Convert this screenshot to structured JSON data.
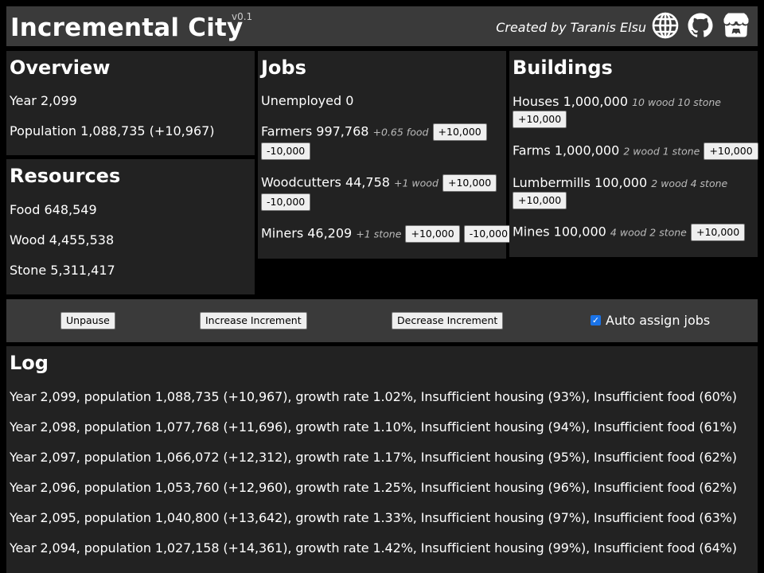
{
  "header": {
    "title": "Incremental City",
    "version": "v0.1",
    "credit": "Created by Taranis Elsu"
  },
  "overview": {
    "title": "Overview",
    "year": "Year 2,099",
    "population": "Population 1,088,735 (+10,967)"
  },
  "resources": {
    "title": "Resources",
    "food": "Food 648,549",
    "wood": "Wood 4,455,538",
    "stone": "Stone 5,311,417"
  },
  "jobs": {
    "title": "Jobs",
    "unemployed": "Unemployed 0",
    "farmers": {
      "label": "Farmers 997,768",
      "yield": "+0.65 food",
      "inc": "+10,000",
      "dec": "-10,000"
    },
    "woodcutters": {
      "label": "Woodcutters 44,758",
      "yield": "+1 wood",
      "inc": "+10,000",
      "dec": "-10,000"
    },
    "miners": {
      "label": "Miners 46,209",
      "yield": "+1 stone",
      "inc": "+10,000",
      "dec": "-10,000"
    }
  },
  "buildings": {
    "title": "Buildings",
    "houses": {
      "label": "Houses 1,000,000",
      "cost": "10 wood 10 stone",
      "inc": "+10,000"
    },
    "farms": {
      "label": "Farms 1,000,000",
      "cost": "2 wood 1 stone",
      "inc": "+10,000"
    },
    "lumbermills": {
      "label": "Lumbermills 100,000",
      "cost": "2 wood 4 stone",
      "inc": "+10,000"
    },
    "mines": {
      "label": "Mines 100,000",
      "cost": "4 wood 2 stone",
      "inc": "+10,000"
    }
  },
  "controls": {
    "unpause": "Unpause",
    "increase": "Increase Increment",
    "decrease": "Decrease Increment",
    "auto_assign": "Auto assign jobs",
    "auto_assign_checked": true
  },
  "log": {
    "title": "Log",
    "entries": [
      "Year 2,099, population 1,088,735 (+10,967), growth rate 1.02%, Insufficient housing (93%), Insufficient food (60%)",
      "Year 2,098, population 1,077,768 (+11,696), growth rate 1.10%, Insufficient housing (94%), Insufficient food (61%)",
      "Year 2,097, population 1,066,072 (+12,312), growth rate 1.17%, Insufficient housing (95%), Insufficient food (62%)",
      "Year 2,096, population 1,053,760 (+12,960), growth rate 1.25%, Insufficient housing (96%), Insufficient food (62%)",
      "Year 2,095, population 1,040,800 (+13,642), growth rate 1.33%, Insufficient housing (97%), Insufficient food (63%)",
      "Year 2,094, population 1,027,158 (+14,361), growth rate 1.42%, Insufficient housing (99%), Insufficient food (64%)"
    ]
  },
  "icons": [
    "globe-icon",
    "github-icon",
    "itch-io-icon"
  ]
}
